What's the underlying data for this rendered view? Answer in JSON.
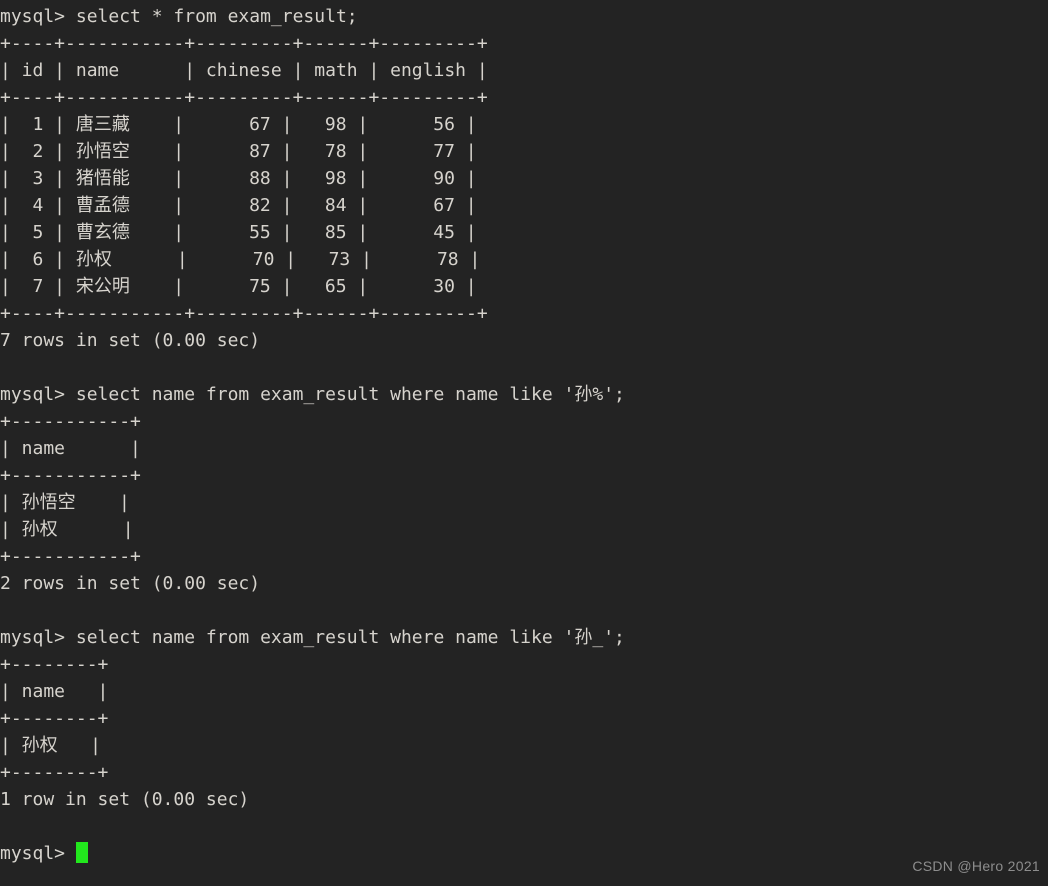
{
  "terminal": {
    "background_color": "#232323",
    "text_color": "#d6d3cd",
    "cursor_color": "#22e81d",
    "prompt": "mysql> "
  },
  "watermark": {
    "text": "CSDN @Hero 2021",
    "color": "#8d8d8d"
  },
  "blocks": [
    {
      "command": "mysql> select * from exam_result;",
      "table": {
        "separator": "+----+-----------+---------+------+---------+",
        "header": "| id | name      | chinese | math | english |",
        "columns": [
          "id",
          "name",
          "chinese",
          "math",
          "english"
        ],
        "rows": [
          "|  1 | 唐三藏    |      67 |   98 |      56 |",
          "|  2 | 孙悟空    |      87 |   78 |      77 |",
          "|  3 | 猪悟能    |      88 |   98 |      90 |",
          "|  4 | 曹孟德    |      82 |   84 |      67 |",
          "|  5 | 曹玄德    |      55 |   85 |      45 |",
          "|  6 | 孙权      |      70 |   73 |      78 |",
          "|  7 | 宋公明    |      75 |   65 |      30 |"
        ],
        "records": [
          {
            "id": "1",
            "name": "唐三藏",
            "chinese": "67",
            "math": "98",
            "english": "56"
          },
          {
            "id": "2",
            "name": "孙悟空",
            "chinese": "87",
            "math": "78",
            "english": "77"
          },
          {
            "id": "3",
            "name": "猪悟能",
            "chinese": "88",
            "math": "98",
            "english": "90"
          },
          {
            "id": "4",
            "name": "曹孟德",
            "chinese": "82",
            "math": "84",
            "english": "67"
          },
          {
            "id": "5",
            "name": "曹玄德",
            "chinese": "55",
            "math": "85",
            "english": "45"
          },
          {
            "id": "6",
            "name": "孙权",
            "chinese": "70",
            "math": "73",
            "english": "78"
          },
          {
            "id": "7",
            "name": "宋公明",
            "chinese": "75",
            "math": "65",
            "english": "30"
          }
        ]
      },
      "status": "7 rows in set (0.00 sec)"
    },
    {
      "command": "mysql> select name from exam_result where name like '孙%';",
      "table": {
        "separator": "+-----------+",
        "header": "| name      |",
        "columns": [
          "name"
        ],
        "rows": [
          "| 孙悟空    |",
          "| 孙权      |"
        ],
        "records": [
          {
            "name": "孙悟空"
          },
          {
            "name": "孙权"
          }
        ]
      },
      "status": "2 rows in set (0.00 sec)"
    },
    {
      "command": "mysql> select name from exam_result where name like '孙_';",
      "table": {
        "separator": "+--------+",
        "header": "| name   |",
        "columns": [
          "name"
        ],
        "rows": [
          "| 孙权   |"
        ],
        "records": [
          {
            "name": "孙权"
          }
        ]
      },
      "status": "1 row in set (0.00 sec)"
    }
  ],
  "final_prompt": "mysql> "
}
